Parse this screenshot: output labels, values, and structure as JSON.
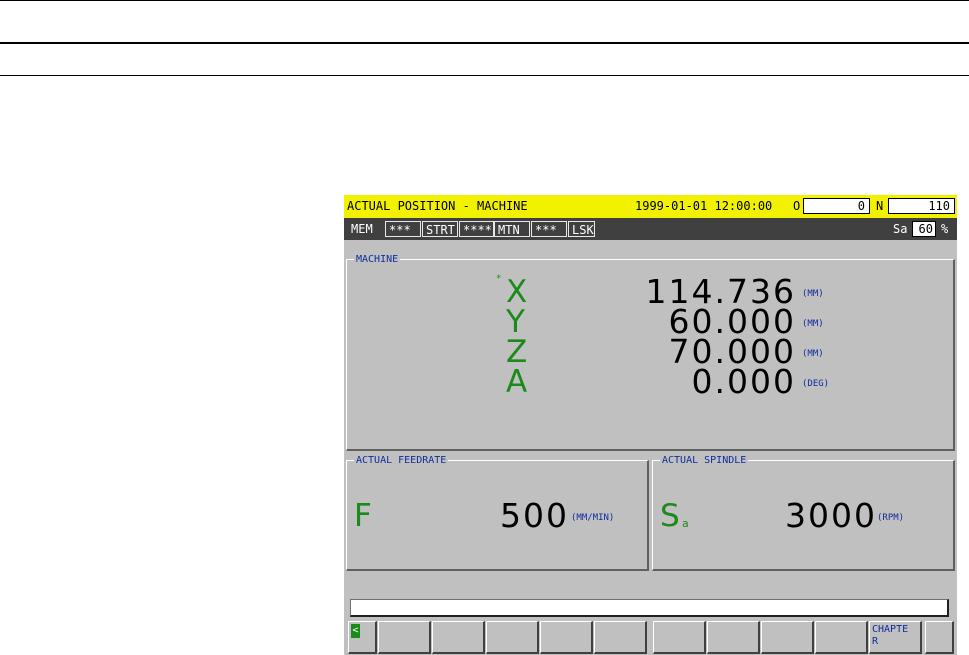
{
  "title_bar": {
    "screen_title": "ACTUAL POSITION - MACHINE",
    "datetime": "1999-01-01 12:00:00",
    "o_label": "O",
    "o_value": "0",
    "n_label": "N",
    "n_value": "110"
  },
  "status_bar": {
    "mode": "MEM",
    "s1": "***",
    "state": "STRT",
    "s2": "****",
    "motion": "MTN",
    "s3": "***",
    "lsk": "LSK",
    "sa_label": "Sa",
    "sa_value": "60",
    "sa_unit": "%"
  },
  "machine_panel": {
    "title": "MACHINE",
    "axes": [
      {
        "name": "X",
        "value": "114.736",
        "unit": "(MM)",
        "marker": "*"
      },
      {
        "name": "Y",
        "value": "60.000",
        "unit": "(MM)",
        "marker": ""
      },
      {
        "name": "Z",
        "value": "70.000",
        "unit": "(MM)",
        "marker": ""
      },
      {
        "name": "A",
        "value": "0.000",
        "unit": "(DEG)",
        "marker": ""
      }
    ]
  },
  "feedrate_panel": {
    "title": "ACTUAL FEEDRATE",
    "letter": "F",
    "value": "500",
    "unit": "(MM/MIN)"
  },
  "spindle_panel": {
    "title": "ACTUAL SPINDLE",
    "letter": "S",
    "subscript": "a",
    "value": "3000",
    "unit": "(RPM)"
  },
  "input_line": {
    "value": ""
  },
  "softkeys": {
    "left_arrow": "<",
    "chapter_label": "CHAPTE R",
    "keys": [
      "",
      "",
      "",
      "",
      "",
      "",
      "",
      "",
      "",
      ""
    ]
  },
  "colors": {
    "title_bar_bg": "#f2f200",
    "status_bar_bg": "#404040",
    "panel_bg": "#c0c0c0",
    "axis_letter": "#1a8a1a",
    "label_blue": "#102c9c"
  }
}
